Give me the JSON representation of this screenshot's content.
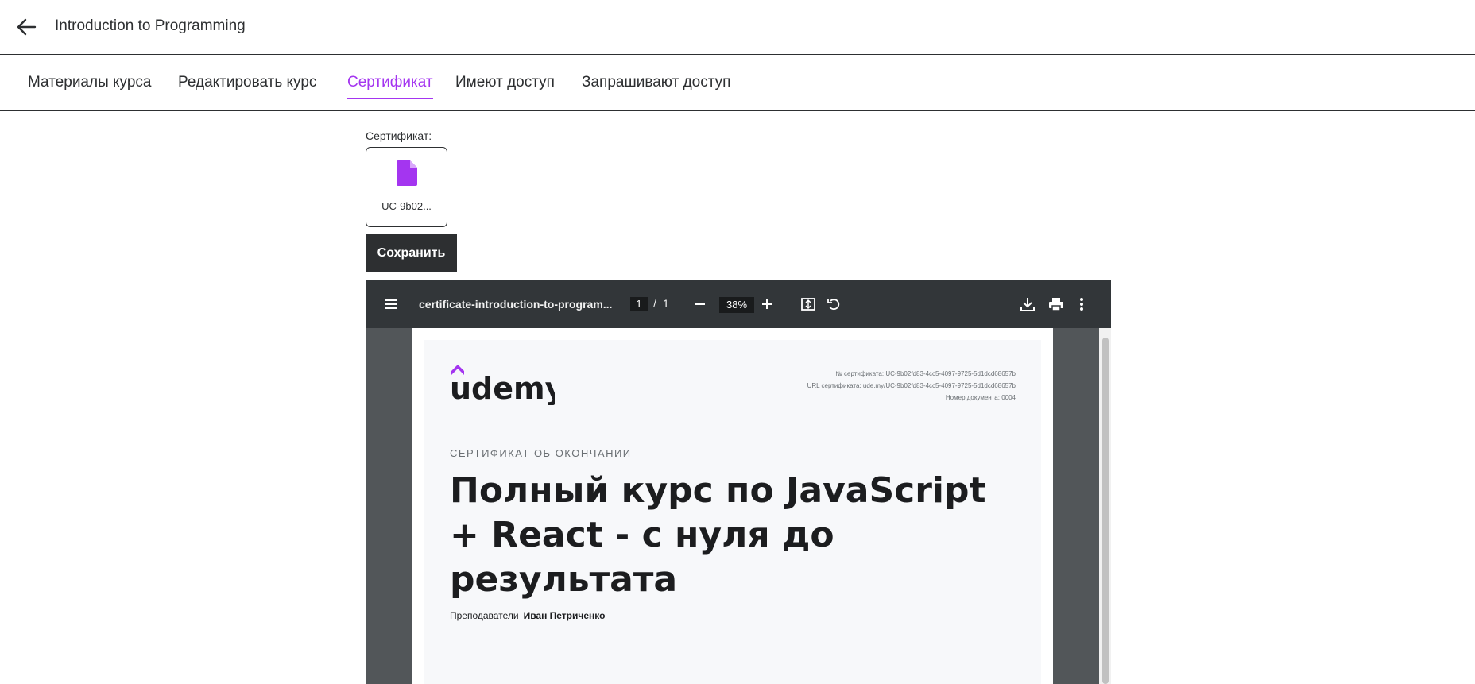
{
  "header": {
    "title": "Introduction to Programming"
  },
  "tabs": [
    {
      "label": "Материалы курса"
    },
    {
      "label": "Редактировать курс"
    },
    {
      "label": "Сертификат"
    },
    {
      "label": "Имеют доступ"
    },
    {
      "label": "Запрашивают доступ"
    }
  ],
  "active_tab": "Сертификат",
  "certificate_section": {
    "label": "Сертификат:",
    "file_name": "UC-9b02...",
    "save_label": "Сохранить"
  },
  "pdf_viewer": {
    "doc_name": "certificate-introduction-to-program...",
    "page_current": "1",
    "page_sep": "/",
    "page_total": "1",
    "zoom": "38%",
    "icons": [
      "menu-icon",
      "zoom-out-icon",
      "zoom-in-icon",
      "fit-page-icon",
      "rotate-icon",
      "download-icon",
      "print-icon",
      "more-icon"
    ]
  },
  "certificate": {
    "logo_text": "udemy",
    "meta_number": "№ сертификата: UC-9b02fd83-4cc5-4097-9725-5d1dcd68657b",
    "meta_url": "URL сертификата: ude.my/UC-9b02fd83-4cc5-4097-9725-5d1dcd68657b",
    "meta_doc": "Номер документа: 0004",
    "kicker": "СЕРТИФИКАТ ОБ ОКОНЧАНИИ",
    "course_title": "Полный курс по JavaScript + React - с нуля до результата",
    "instructors_label": "Преподаватели",
    "instructor_name": "Иван Петриченко"
  },
  "colors": {
    "accent": "#a435f0",
    "dark": "#2d2f31",
    "viewer_bg": "#525659",
    "viewer_toolbar": "#323639"
  }
}
